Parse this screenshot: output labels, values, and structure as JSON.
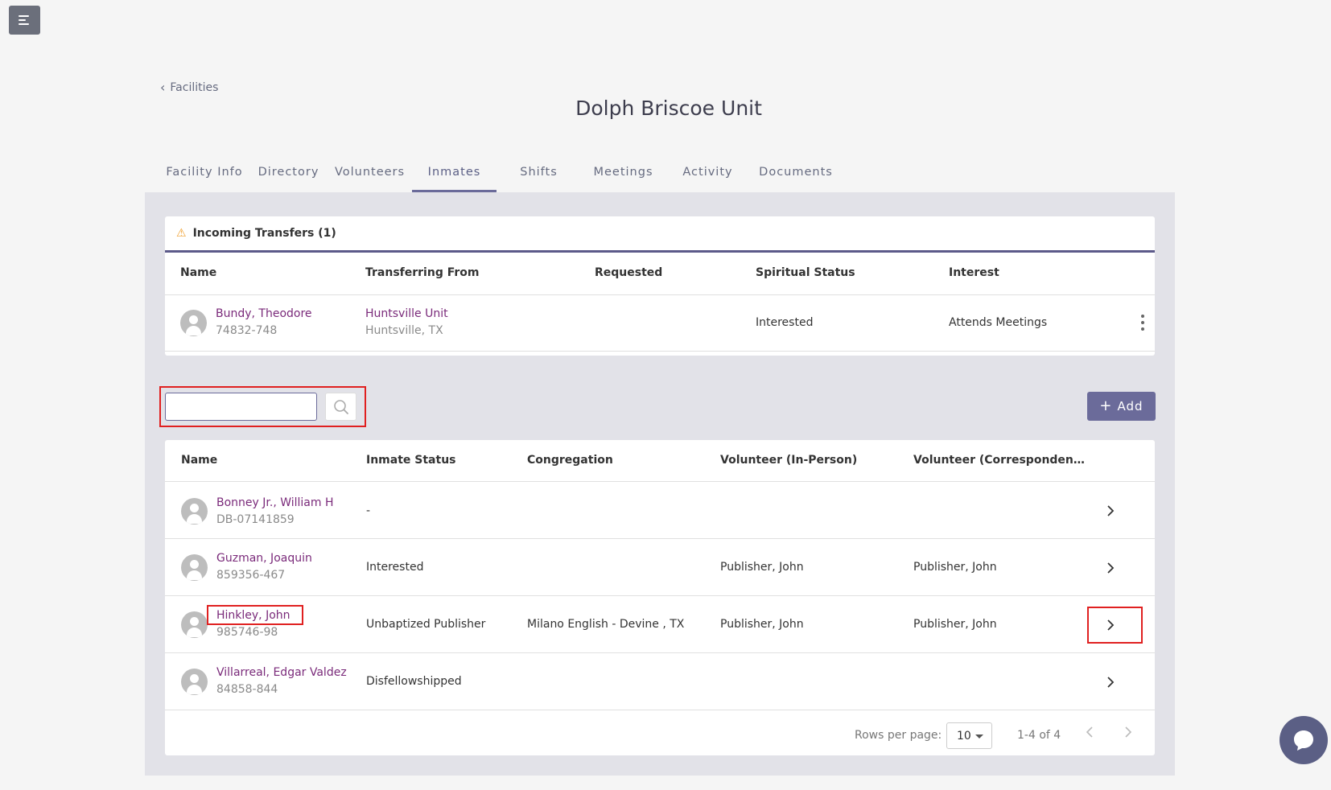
{
  "nav": {
    "back_label": "Facilities"
  },
  "page": {
    "title": "Dolph Briscoe Unit"
  },
  "tabs": [
    {
      "label": "Facility Info"
    },
    {
      "label": "Directory"
    },
    {
      "label": "Volunteers"
    },
    {
      "label": "Inmates",
      "active": true
    },
    {
      "label": "Shifts"
    },
    {
      "label": "Meetings"
    },
    {
      "label": "Activity"
    },
    {
      "label": "Documents"
    }
  ],
  "transfers": {
    "title": "Incoming Transfers (1)",
    "headers": [
      "Name",
      "Transferring From",
      "Requested",
      "Spiritual Status",
      "Interest"
    ],
    "rows": [
      {
        "name": "Bundy, Theodore",
        "id": "74832-748",
        "from_unit": "Huntsville Unit",
        "from_city": "Huntsville, TX",
        "requested": "",
        "status": "Interested",
        "interest": "Attends Meetings"
      }
    ]
  },
  "search": {
    "value": "",
    "placeholder": ""
  },
  "add_button": {
    "label": "Add"
  },
  "inmates": {
    "headers": [
      "Name",
      "Inmate Status",
      "Congregation",
      "Volunteer (In-Person)",
      "Volunteer (Corresponden…"
    ],
    "rows": [
      {
        "name": "Bonney Jr., William H",
        "id": "DB-07141859",
        "status": "-",
        "congregation": "",
        "vol_in_person": "",
        "vol_corr": ""
      },
      {
        "name": "Guzman, Joaquin",
        "id": "859356-467",
        "status": "Interested",
        "congregation": "",
        "vol_in_person": "Publisher, John",
        "vol_corr": "Publisher, John"
      },
      {
        "name": "Hinkley, John",
        "id": "985746-98",
        "status": "Unbaptized Publisher",
        "congregation": "Milano English - Devine , TX",
        "vol_in_person": "Publisher, John",
        "vol_corr": "Publisher, John"
      },
      {
        "name": "Villarreal, Edgar Valdez",
        "id": "84858-844",
        "status": "Disfellowshipped",
        "congregation": "",
        "vol_in_person": "",
        "vol_corr": ""
      }
    ]
  },
  "pagination": {
    "rows_per_page_label": "Rows per page:",
    "rows_per_page": "10",
    "range": "1-4 of 4"
  },
  "colors": {
    "accent": "#6b6b9a",
    "link": "#7a2a7a",
    "highlight": "#e02020"
  }
}
